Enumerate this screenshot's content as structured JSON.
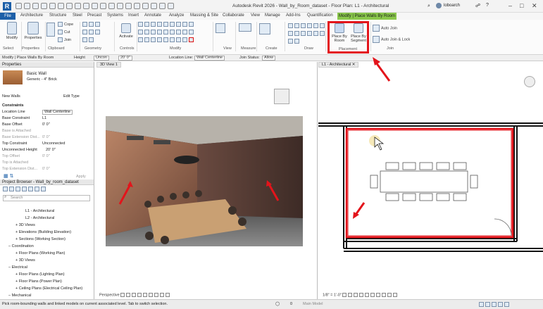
{
  "app": {
    "title": "Autodesk Revit 2026 - Wall_by_Room_dataset - Floor Plan: L1 - Architectural",
    "user": "loboarch"
  },
  "menu": {
    "file": "File",
    "tabs": [
      "Architecture",
      "Structure",
      "Steel",
      "Precast",
      "Systems",
      "Insert",
      "Annotate",
      "Analyze",
      "Massing & Site",
      "Collaborate",
      "View",
      "Manage",
      "Add-Ins",
      "Quantification"
    ],
    "active": "Modify | Place Walls By Room"
  },
  "ribbon": {
    "modify": "Modify",
    "properties": "Properties",
    "cope": "Cope",
    "cut": "Cut",
    "join": "Join",
    "activate": "Activate",
    "place_by_room": "Place By Room",
    "place_by_segment": "Place By Segment",
    "auto_join": "Auto Join",
    "auto_join_lock": "Auto Join & Lock",
    "groups": [
      "Select",
      "Properties",
      "Clipboard",
      "Geometry",
      "Controls",
      "Modify",
      "View",
      "Measure",
      "Create",
      "Draw",
      "Placement",
      "Join"
    ]
  },
  "options": {
    "context": "Modify | Place Walls By Room",
    "height_label": "Height",
    "height_value": "Uncon",
    "height_dim": "20' 0\"",
    "location_label": "Location Line:",
    "location_value": "Wall Centerline",
    "join_label": "Join Status:",
    "join_value": "Allow"
  },
  "properties": {
    "header": "Properties",
    "type_name": "Basic Wall",
    "type_sub": "Generic - 4\" Brick",
    "selector": "New Walls",
    "edit_type": "Edit Type",
    "section": "Constraints",
    "rows": [
      {
        "k": "Location Line",
        "v": "Wall Centerline"
      },
      {
        "k": "Base Constraint",
        "v": "L1"
      },
      {
        "k": "Base Offset",
        "v": "0' 0\""
      },
      {
        "k": "Base is Attached",
        "v": ""
      },
      {
        "k": "Base Extension Dist...",
        "v": "0' 0\""
      },
      {
        "k": "Top Constraint",
        "v": "Unconnected"
      },
      {
        "k": "Unconnected Height",
        "v": "20' 0\""
      },
      {
        "k": "Top Offset",
        "v": "0' 0\""
      },
      {
        "k": "Top is Attached",
        "v": ""
      },
      {
        "k": "Top Extension Dist...",
        "v": "0' 0\""
      }
    ],
    "apply": "Apply"
  },
  "browser": {
    "header": "Project Browser - Wall_by_room_dataset",
    "search": "Search",
    "items": [
      {
        "t": "L1 - Architectural",
        "d": 4
      },
      {
        "t": "L2 - Architectural",
        "d": 4
      },
      {
        "t": "3D Views",
        "d": 2
      },
      {
        "t": "Elevations (Building Elevation)",
        "d": 2
      },
      {
        "t": "Sections (Working Section)",
        "d": 2
      },
      {
        "t": "Coordination",
        "d": 1
      },
      {
        "t": "Floor Plans (Working Plan)",
        "d": 2
      },
      {
        "t": "3D Views",
        "d": 2
      },
      {
        "t": "Electrical",
        "d": 1
      },
      {
        "t": "Floor Plans (Lighting Plan)",
        "d": 2
      },
      {
        "t": "Floor Plans (Power Plan)",
        "d": 2
      },
      {
        "t": "Ceiling Plans (Electrical Ceiling Plan)",
        "d": 2
      },
      {
        "t": "Mechanical",
        "d": 1
      }
    ]
  },
  "views": {
    "v3d_tab": "3D View 1",
    "plan_tab": "L1 - Architectural",
    "v3d_ctrl": "Perspective",
    "plan_scale": "1/8\" = 1'-0\"",
    "main_model": "Main Model"
  },
  "status": {
    "text": "Pick room-bounding walls and linked models on current associated level. Tab to switch selection.",
    "count": "0"
  },
  "colors": {
    "highlight": "#e3141b",
    "accent": "#1c5fa8",
    "modify_tab": "#8ac84b"
  }
}
